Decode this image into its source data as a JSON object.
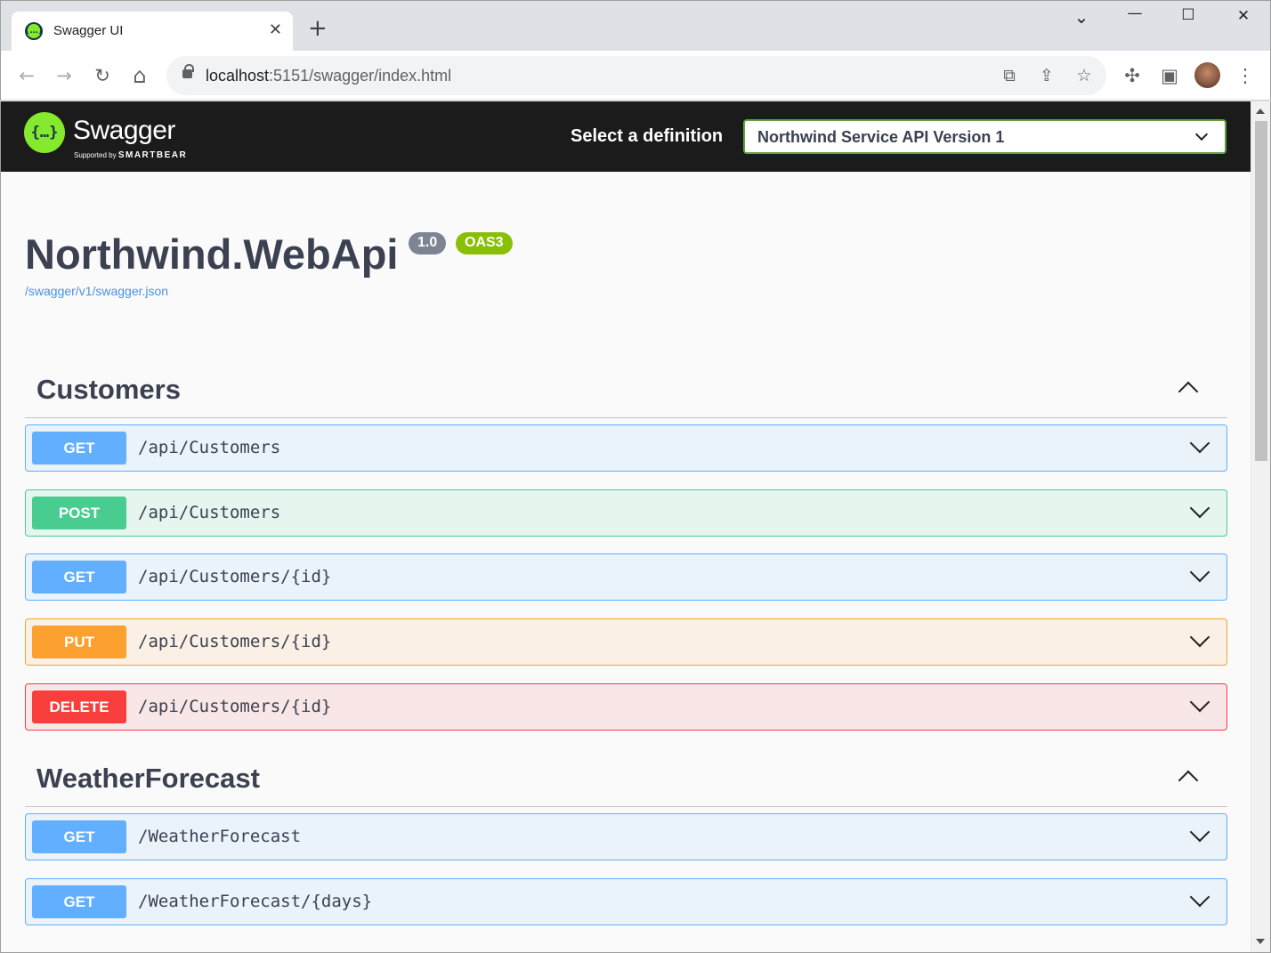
{
  "browser": {
    "tab_title": "Swagger UI",
    "tab_close": "✕",
    "new_tab": "+",
    "url_host": "localhost",
    "url_rest": ":5151/swagger/index.html",
    "window": {
      "minimize": "—",
      "maximize": "☐",
      "close": "✕",
      "tabsearch": "⌄"
    },
    "icons": {
      "back": "←",
      "forward": "→",
      "reload": "↻",
      "home": "⌂",
      "open_in": "⧉",
      "share": "⇪",
      "bookmark": "☆",
      "extensions": "✣",
      "sidepanel": "▣",
      "menu": "⋮"
    }
  },
  "swagger": {
    "logo_text": "Swagger",
    "logo_sub_prefix": "Supported by",
    "logo_sub_brand": "SMARTBEAR",
    "logo_glyph": "{…}",
    "definition_label": "Select a definition",
    "definition_value": "Northwind Service API Version 1",
    "api_title": "Northwind.WebApi",
    "version_badge": "1.0",
    "oas_badge": "OAS3",
    "spec_link": "/swagger/v1/swagger.json"
  },
  "tags": [
    {
      "name": "Customers",
      "operations": [
        {
          "method": "GET",
          "path": "/api/Customers"
        },
        {
          "method": "POST",
          "path": "/api/Customers"
        },
        {
          "method": "GET",
          "path": "/api/Customers/{id}"
        },
        {
          "method": "PUT",
          "path": "/api/Customers/{id}"
        },
        {
          "method": "DELETE",
          "path": "/api/Customers/{id}"
        }
      ]
    },
    {
      "name": "WeatherForecast",
      "operations": [
        {
          "method": "GET",
          "path": "/WeatherForecast"
        },
        {
          "method": "GET",
          "path": "/WeatherForecast/{days}"
        }
      ]
    }
  ],
  "colors": {
    "get": "#61affe",
    "post": "#49cc90",
    "put": "#fca130",
    "delete": "#f93e3e",
    "swagger_green": "#85ea2d",
    "topbar": "#1b1b1b",
    "version_badge": "#7d8492",
    "oas_badge": "#89bf04"
  }
}
